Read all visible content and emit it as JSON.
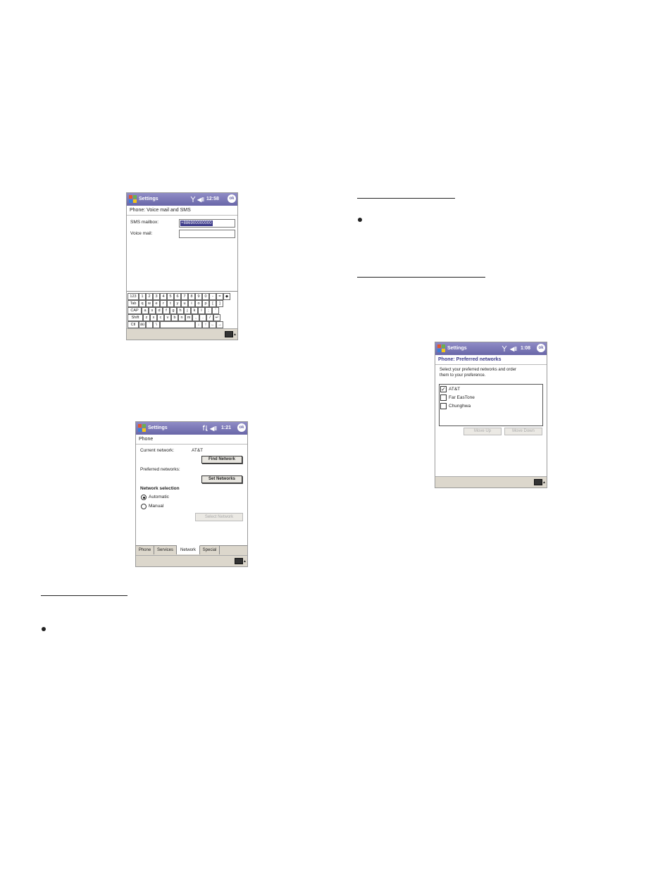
{
  "screen1": {
    "title": "Settings",
    "time": "12:58",
    "ok": "ok",
    "header": "Phone: Voice mail and SMS",
    "sms_label": "SMS mailbox:",
    "sms_value": "+886900000000",
    "voice_label": "Voice mail:",
    "voice_value": "",
    "keyboard": [
      [
        "123",
        "1",
        "2",
        "3",
        "4",
        "5",
        "6",
        "7",
        "8",
        "9",
        "0",
        "-",
        "=",
        "◆"
      ],
      [
        "Tab",
        "q",
        "w",
        "e",
        "r",
        "t",
        "y",
        "u",
        "i",
        "o",
        "p",
        "[",
        "]"
      ],
      [
        "CAP",
        "a",
        "s",
        "d",
        "f",
        "g",
        "h",
        "j",
        "k",
        "l",
        ";",
        "'"
      ],
      [
        "Shift",
        "z",
        "x",
        "c",
        "v",
        "b",
        "n",
        "m",
        ",",
        ".",
        "/",
        "↵"
      ],
      [
        "Ctl",
        "áü",
        "`",
        "\\",
        "",
        "↓",
        "↑",
        "←",
        "→"
      ]
    ]
  },
  "screen2": {
    "title": "Settings",
    "time": "1:21",
    "ok": "ok",
    "header": "Phone",
    "current_network_label": "Current network:",
    "current_network_value": "AT&T",
    "find_network": "Find Network",
    "preferred_label": "Preferred networks:",
    "set_networks": "Set Networks",
    "selection_heading": "Network selection",
    "automatic": "Automatic",
    "manual": "Manual",
    "select_network": "Select Network",
    "tabs": [
      "Phone",
      "Services",
      "Network",
      "Special"
    ],
    "active_tab": "Network"
  },
  "screen3": {
    "title": "Settings",
    "time": "1:08",
    "ok": "ok",
    "header": "Phone: Preferred networks",
    "instructions_line1": "Select your preferred networks and order",
    "instructions_line2": "them to your preference.",
    "networks": [
      {
        "name": "AT&T",
        "checked": true
      },
      {
        "name": "Far EasTone",
        "checked": false
      },
      {
        "name": "Chunghwa",
        "checked": false
      }
    ],
    "move_up": "Move Up",
    "move_down": "Move Down"
  }
}
